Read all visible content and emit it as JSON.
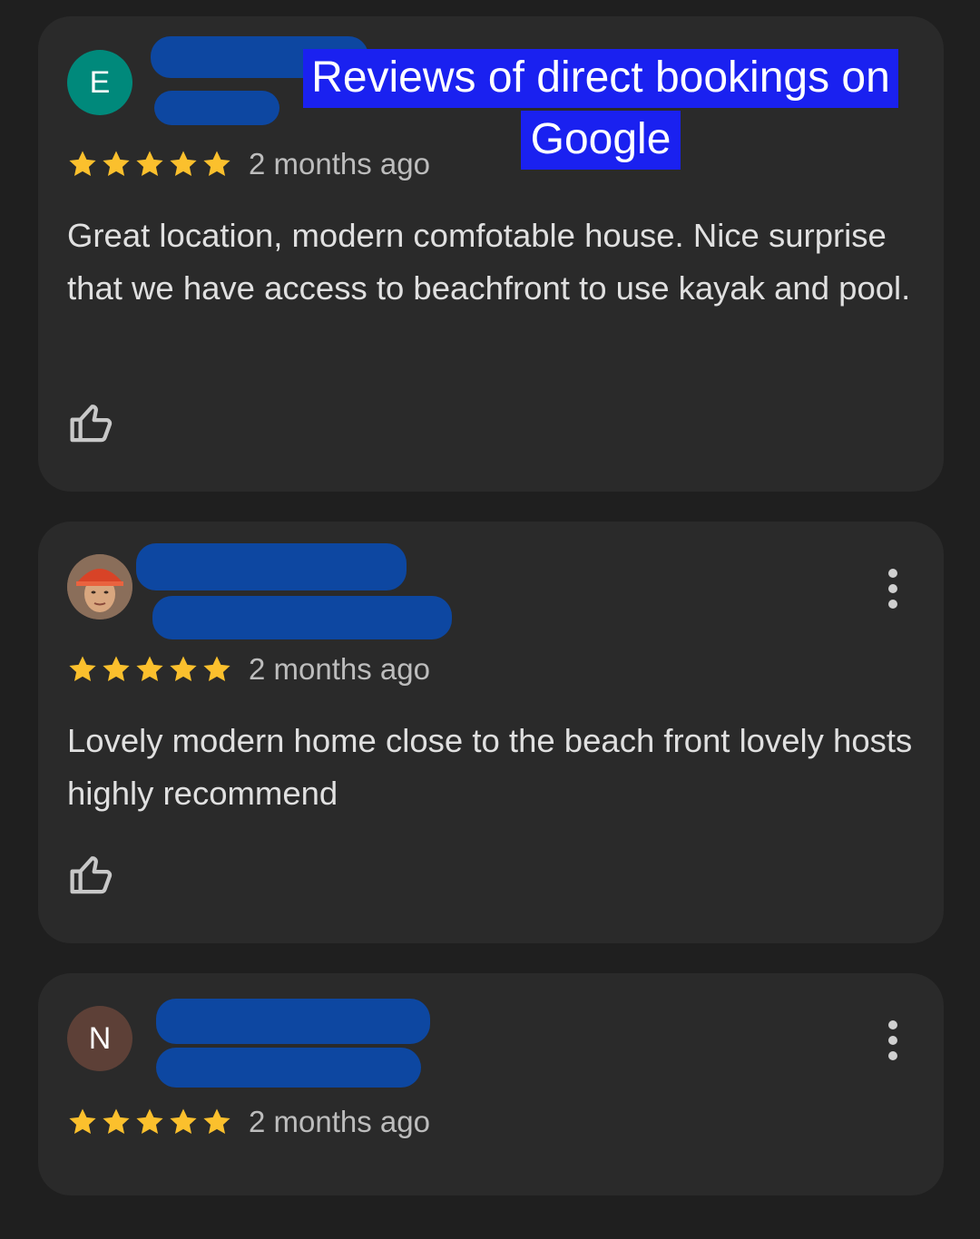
{
  "overlay_caption": {
    "line1": "Reviews of direct bookings on",
    "line2": "Google"
  },
  "reviews": [
    {
      "avatar_letter": "E",
      "avatar_color": "#00897b",
      "rating": 5,
      "time": "2 months ago",
      "text": "Great location, modern comfotable house. Nice surprise that we have access to beachfront to use kayak and pool."
    },
    {
      "avatar_letter": "",
      "avatar_type": "photo",
      "rating": 5,
      "time": "2 months ago",
      "text": "Lovely modern home close to the beach front lovely hosts highly recommend"
    },
    {
      "avatar_letter": "N",
      "avatar_color": "#5d4037",
      "rating": 5,
      "time": "2 months ago"
    }
  ],
  "colors": {
    "background": "#1f1f1f",
    "card": "#2a2a2a",
    "star": "#fbc02d",
    "redaction": "#0d47a1",
    "caption_highlight": "#1a21f0"
  },
  "icons": [
    "star-icon",
    "thumbs-up-icon",
    "more-vert-icon"
  ]
}
